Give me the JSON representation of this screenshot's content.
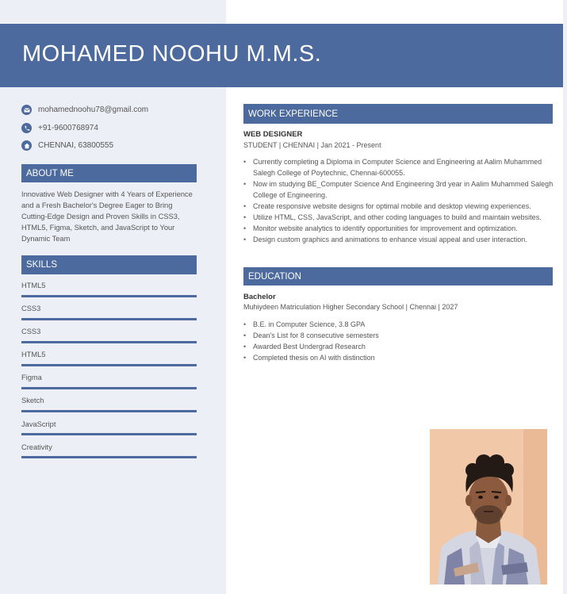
{
  "name": "MOHAMED NOOHU M.M.S.",
  "contact": {
    "email": "mohamednoohu78@gmail.com",
    "phone": "+91-9600768974",
    "address": "CHENNAI, 63800555"
  },
  "about": {
    "heading": "ABOUT ME",
    "text": "Innovative Web Designer with 4 Years of Experience and a Fresh Bachelor's Degree Eager to Bring Cutting-Edge Design and Proven Skills in CSS3, HTML5, Figma, Sketch, and JavaScript to Your Dynamic Team"
  },
  "skills": {
    "heading": "SKILLS",
    "items": [
      "HTML5",
      "CSS3",
      "CSS3",
      "HTML5",
      "Figma",
      "Sketch",
      "JavaScript",
      "Creativity"
    ]
  },
  "work": {
    "heading": "WORK EXPERIENCE",
    "title": "WEB DESIGNER",
    "meta": "STUDENT | CHENNAI | Jan 2021 - Present",
    "bullets": [
      "Currently completing a Diploma in Computer Science and Engineering at Aalim Muhammed Salegh College of Poytechnic, Chennai-600055.",
      "Now im studying BE_Computer Science And Engineering 3rd year in Aalim Muhammed Salegh College of Engineering.",
      "Create responsive website designs for optimal mobile and desktop viewing experiences.",
      "Utilize HTML, CSS, JavaScript, and other coding languages to build and maintain websites.",
      "Monitor website analytics to identify opportunities for improvement and optimization.",
      "Design custom graphics and animations to enhance visual appeal and user interaction."
    ]
  },
  "education": {
    "heading": "EDUCATION",
    "degree": "Bachelor",
    "school": "Muhiydeen Matriculation Higher Secondary School | Chennai | 2027",
    "bullets": [
      "B.E. in Computer Science, 3.8 GPA",
      "Dean's List for 8 consecutive semesters",
      "Awarded Best Undergrad Research",
      "Completed thesis on AI with distinction"
    ]
  },
  "colors": {
    "accent": "#4d6a9e",
    "sidebar": "#eceff5",
    "photo_bg": "#f0c7a5"
  },
  "icons": [
    "mail-icon",
    "phone-icon",
    "home-icon"
  ]
}
